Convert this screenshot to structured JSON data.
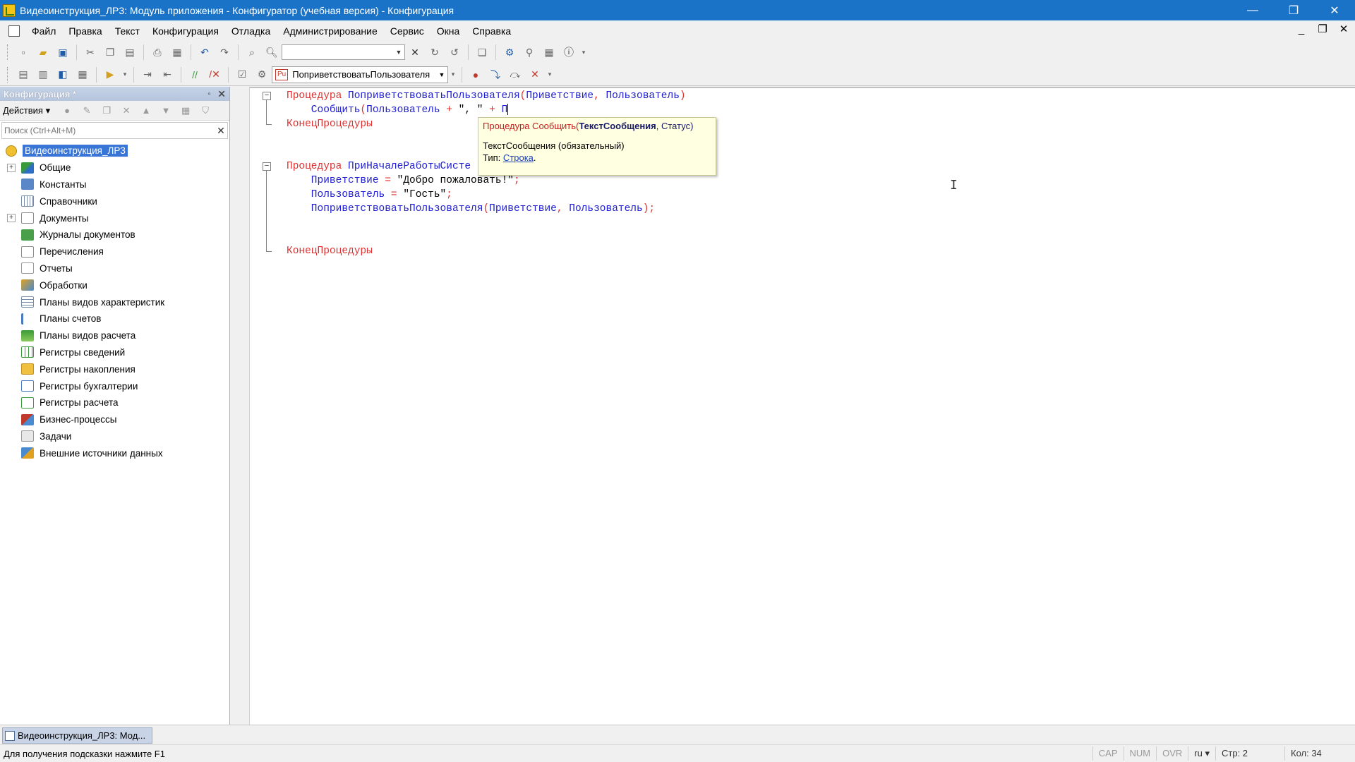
{
  "window": {
    "title": "Видеоинструкция_ЛР3: Модуль приложения - Конфигуратор (учебная версия) - Конфигурация",
    "minimize": "—",
    "restore": "❐",
    "close": "✕"
  },
  "menu": {
    "items": [
      "Файл",
      "Правка",
      "Текст",
      "Конфигурация",
      "Отладка",
      "Администрирование",
      "Сервис",
      "Окна",
      "Справка"
    ],
    "mdi_minimize": "_",
    "mdi_restore": "❐",
    "mdi_close": "✕"
  },
  "toolbar": {
    "search_value": "",
    "procedure_selector": "ПоприветствоватьПользователя",
    "procedure_badge": "Pu"
  },
  "config_panel": {
    "title": "Конфигурация *",
    "pin": "▫",
    "close": "✕",
    "actions_label": "Действия ▾",
    "search_placeholder": "Поиск (Ctrl+Alt+M)",
    "search_clear": "✕",
    "tree": [
      {
        "label": "Видеоинструкция_ЛР3",
        "expander": "",
        "icon": "root",
        "root": true
      },
      {
        "label": "Общие",
        "expander": "+",
        "icon": "general"
      },
      {
        "label": "Константы",
        "expander": "",
        "icon": "const"
      },
      {
        "label": "Справочники",
        "expander": "",
        "icon": "catalog"
      },
      {
        "label": "Документы",
        "expander": "+",
        "icon": "doc"
      },
      {
        "label": "Журналы документов",
        "expander": "",
        "icon": "journal"
      },
      {
        "label": "Перечисления",
        "expander": "",
        "icon": "enum"
      },
      {
        "label": "Отчеты",
        "expander": "",
        "icon": "report"
      },
      {
        "label": "Обработки",
        "expander": "",
        "icon": "proc"
      },
      {
        "label": "Планы видов характеристик",
        "expander": "",
        "icon": "pvh"
      },
      {
        "label": "Планы счетов",
        "expander": "",
        "icon": "accounts"
      },
      {
        "label": "Планы видов расчета",
        "expander": "",
        "icon": "calc"
      },
      {
        "label": "Регистры сведений",
        "expander": "",
        "icon": "reginfo"
      },
      {
        "label": "Регистры накопления",
        "expander": "",
        "icon": "regacc"
      },
      {
        "label": "Регистры бухгалтерии",
        "expander": "",
        "icon": "regbuh"
      },
      {
        "label": "Регистры расчета",
        "expander": "",
        "icon": "regcalc"
      },
      {
        "label": "Бизнес-процессы",
        "expander": "",
        "icon": "bp"
      },
      {
        "label": "Задачи",
        "expander": "",
        "icon": "task"
      },
      {
        "label": "Внешние источники данных",
        "expander": "",
        "icon": "ext"
      }
    ]
  },
  "code": {
    "lines": [
      {
        "fold": "−",
        "tokens": [
          {
            "t": "Процедура ",
            "c": "kw"
          },
          {
            "t": "ПоприветствоватьПользователя",
            "c": "id"
          },
          {
            "t": "(",
            "c": "op"
          },
          {
            "t": "Приветствие",
            "c": "id"
          },
          {
            "t": ", ",
            "c": "op"
          },
          {
            "t": "Пользователь",
            "c": "id"
          },
          {
            "t": ")",
            "c": "op"
          }
        ]
      },
      {
        "fold": "",
        "tokens": [
          {
            "t": "    Сообщить",
            "c": "id"
          },
          {
            "t": "(",
            "c": "op"
          },
          {
            "t": "Пользователь",
            "c": "id"
          },
          {
            "t": " + ",
            "c": "op"
          },
          {
            "t": "\", \"",
            "c": "str"
          },
          {
            "t": " + ",
            "c": "op"
          },
          {
            "t": "П",
            "c": "id"
          }
        ],
        "cursor": true
      },
      {
        "fold": "",
        "tokens": [
          {
            "t": "КонецПроцедуры",
            "c": "kw"
          }
        ]
      },
      {
        "fold": "",
        "tokens": []
      },
      {
        "fold": "",
        "tokens": []
      },
      {
        "fold": "−",
        "tokens": [
          {
            "t": "Процедура ",
            "c": "kw"
          },
          {
            "t": "ПриНачалеРаботыСисте",
            "c": "id"
          }
        ]
      },
      {
        "fold": "",
        "tokens": [
          {
            "t": "    Приветствие",
            "c": "id"
          },
          {
            "t": " = ",
            "c": "op"
          },
          {
            "t": "\"Добро пожаловать!\"",
            "c": "str"
          },
          {
            "t": ";",
            "c": "op"
          }
        ]
      },
      {
        "fold": "",
        "tokens": [
          {
            "t": "    Пользователь",
            "c": "id"
          },
          {
            "t": " = ",
            "c": "op"
          },
          {
            "t": "\"Гость\"",
            "c": "str"
          },
          {
            "t": ";",
            "c": "op"
          }
        ]
      },
      {
        "fold": "",
        "tokens": [
          {
            "t": "    ПоприветствоватьПользователя",
            "c": "id"
          },
          {
            "t": "(",
            "c": "op"
          },
          {
            "t": "Приветствие",
            "c": "id"
          },
          {
            "t": ", ",
            "c": "op"
          },
          {
            "t": "Пользователь",
            "c": "id"
          },
          {
            "t": ");",
            "c": "op"
          }
        ]
      },
      {
        "fold": "",
        "tokens": []
      },
      {
        "fold": "",
        "tokens": []
      },
      {
        "fold": "",
        "tokens": [
          {
            "t": "КонецПроцедуры",
            "c": "kw"
          }
        ]
      }
    ]
  },
  "tooltip": {
    "sig_prefix": "Процедура Сообщить(",
    "sig_param": "ТекстСообщения",
    "sig_rest": ", Статус)",
    "param_desc": "ТекстСообщения (обязательный)",
    "type_label": "Тип: ",
    "type_link": "Строка",
    "type_end": "."
  },
  "windows_bar": {
    "tab_label": "Видеоинструкция_ЛР3: Мод..."
  },
  "status": {
    "hint": "Для получения подсказки нажмите F1",
    "cap": "CAP",
    "num": "NUM",
    "ovr": "OVR",
    "lang": "ru ▾",
    "line": "Стр: 2",
    "col": "Кол: 34"
  }
}
